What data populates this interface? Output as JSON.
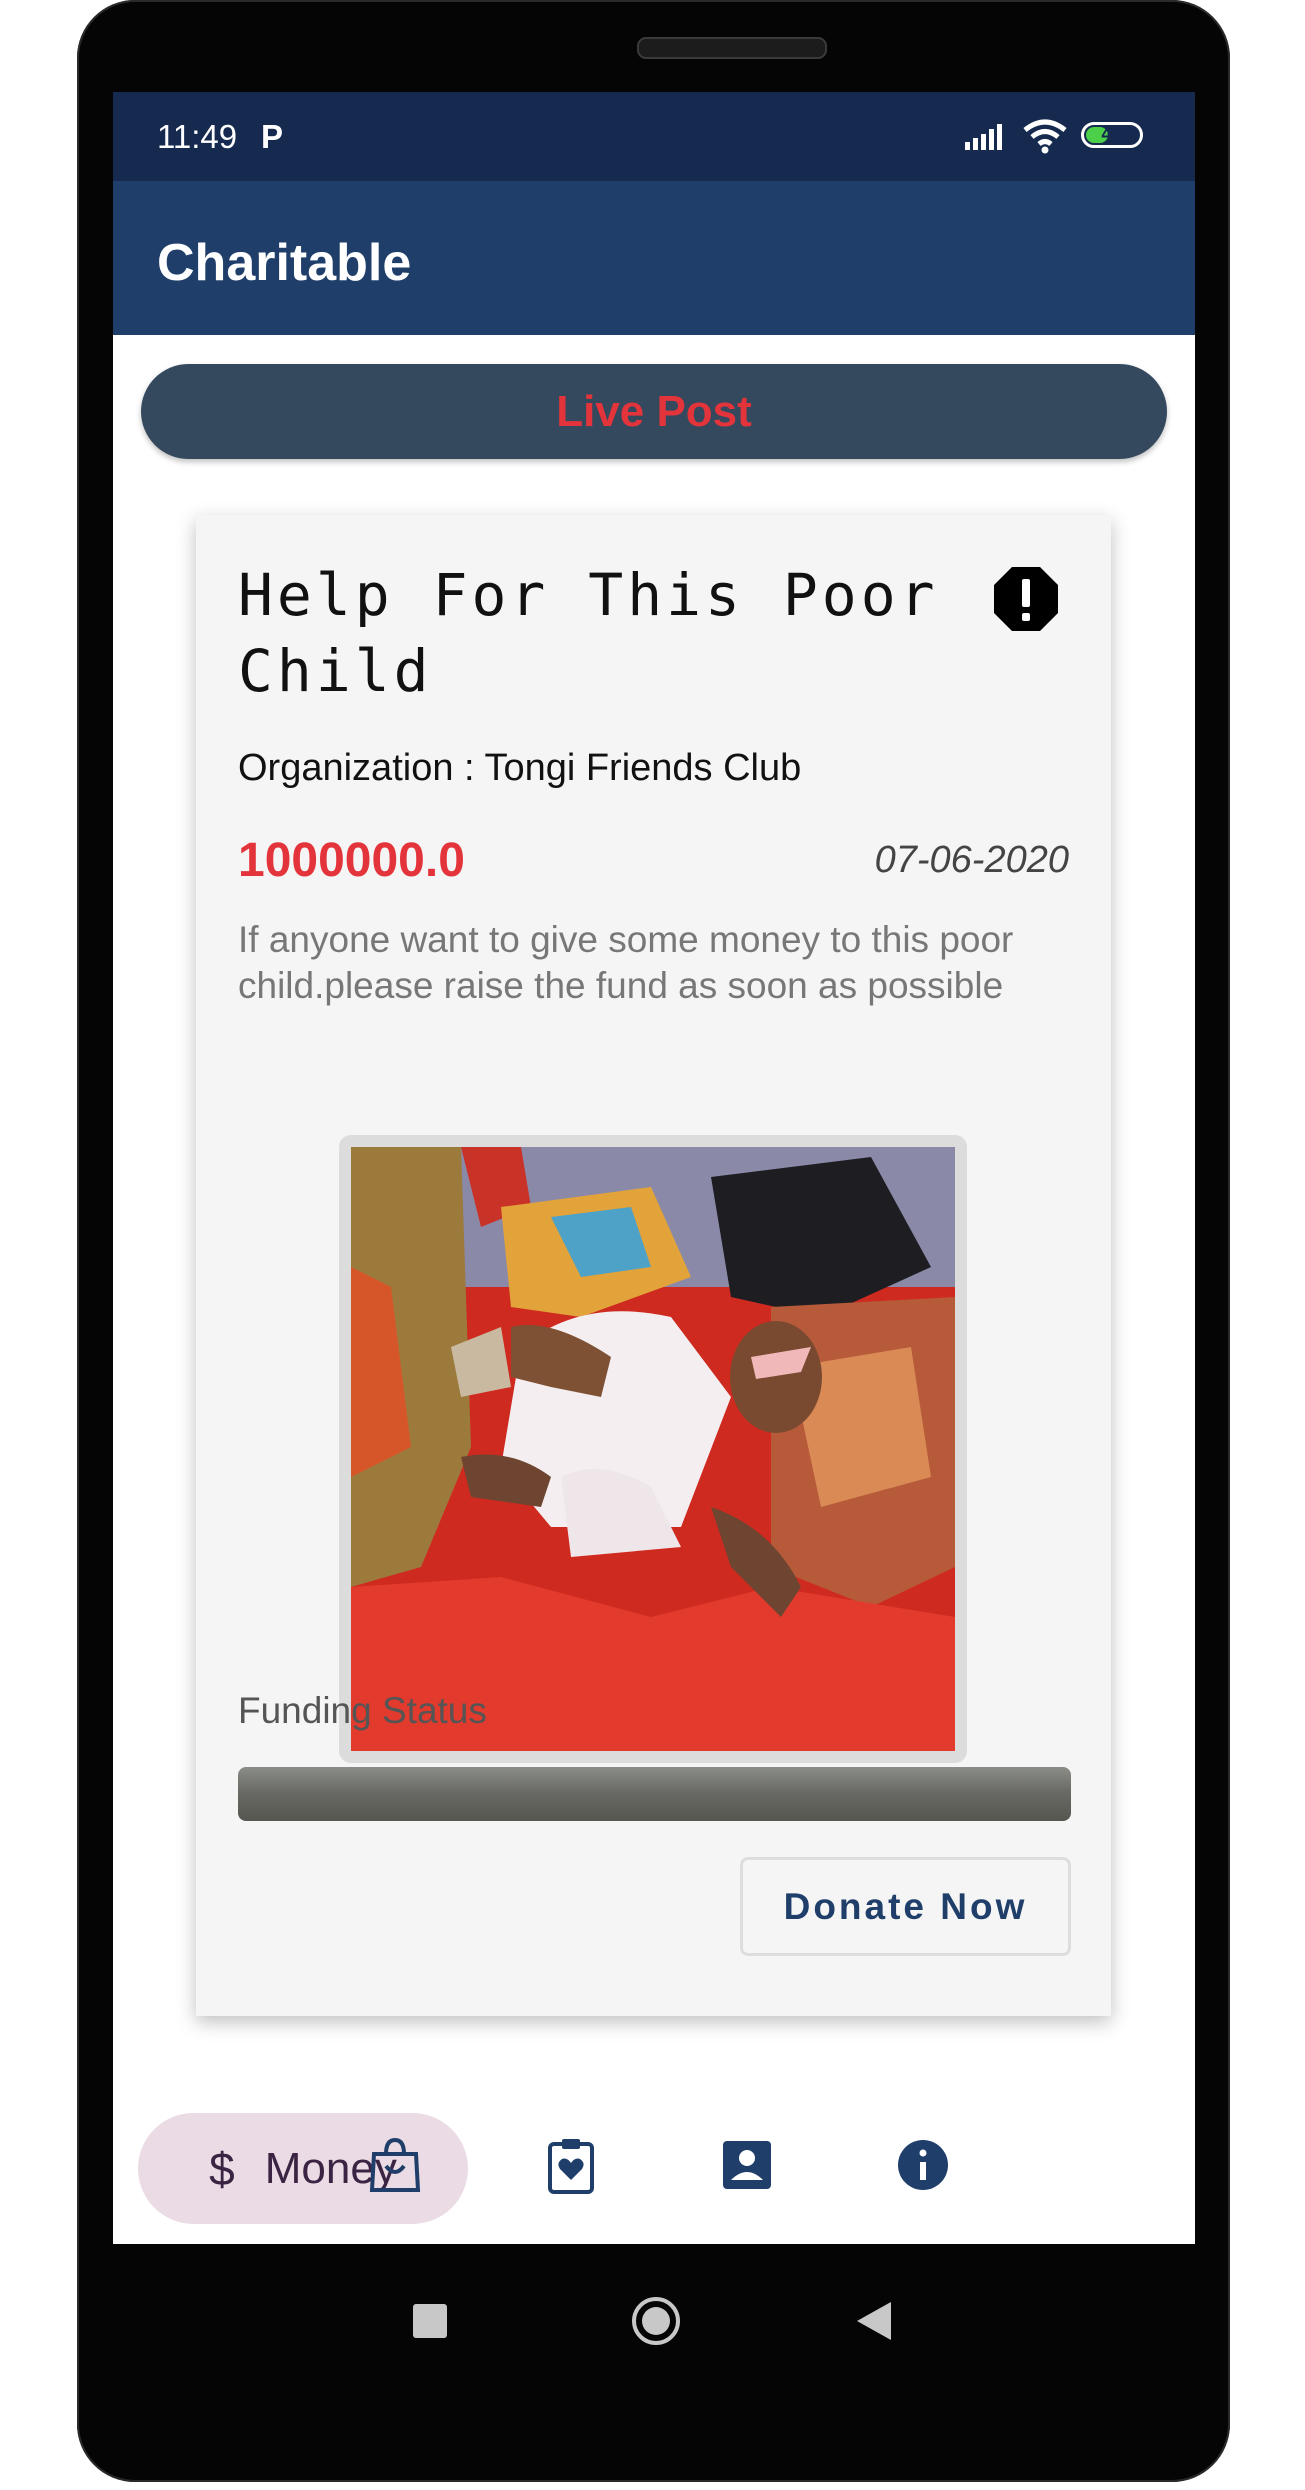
{
  "status_bar": {
    "time": "11:49",
    "notification_app": "P",
    "battery_level": "46",
    "battery_fraction": 0.46
  },
  "app_bar": {
    "title": "Charitable"
  },
  "live_post": {
    "label": "Live Post"
  },
  "post": {
    "title": "Help For This Poor Child",
    "organization": "Organization : Tongi Friends Club",
    "amount": "1000000.0",
    "date": "07-06-2020",
    "description": "If anyone want to give some money to this poor child.please raise the fund as soon as possible",
    "funding_label": "Funding Status",
    "funding_progress": 0,
    "donate_label": "Donate Now"
  },
  "bottom_nav": {
    "items": [
      {
        "label": "Money",
        "icon": "dollar-icon",
        "selected": true
      },
      {
        "label": "",
        "icon": "shopping-bag-icon",
        "selected": false
      },
      {
        "label": "",
        "icon": "clipboard-heart-icon",
        "selected": false
      },
      {
        "label": "",
        "icon": "contact-card-icon",
        "selected": false
      },
      {
        "label": "",
        "icon": "info-icon",
        "selected": false
      }
    ]
  },
  "colors": {
    "status_bar": "#152a4e",
    "app_bar": "#1f3f6a",
    "accent_red": "#e2343a",
    "nav_selected_bg": "#eadbe4"
  }
}
